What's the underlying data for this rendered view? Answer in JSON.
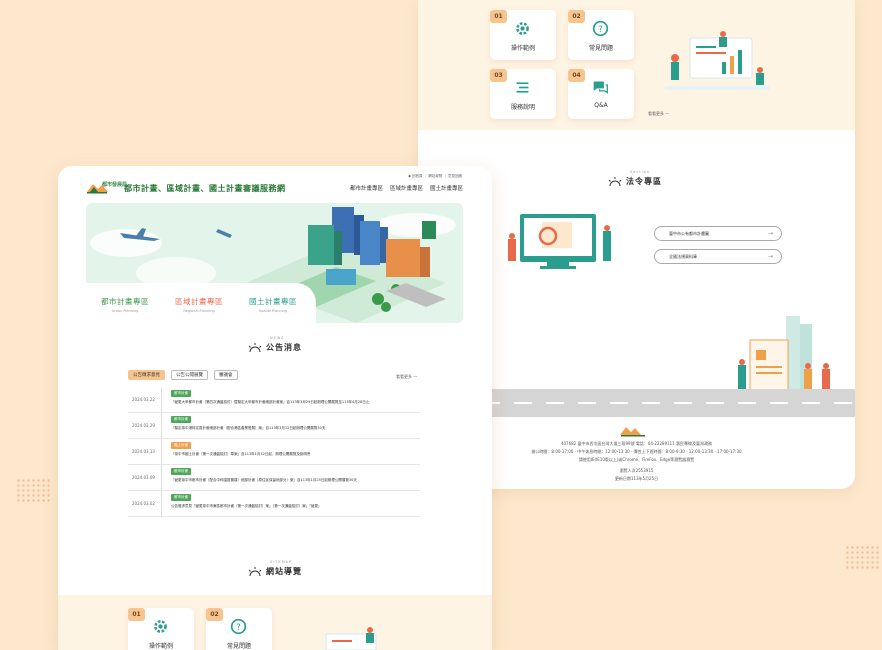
{
  "back": {
    "tiles": [
      {
        "num": "01",
        "label": "操作範例",
        "icon": "gear-icon"
      },
      {
        "num": "02",
        "label": "常見問題",
        "icon": "question-icon"
      },
      {
        "num": "03",
        "label": "服務說明",
        "icon": "list-icon"
      },
      {
        "num": "04",
        "label": "Q&A",
        "icon": "chat-icon"
      }
    ],
    "more_label": "看看更多",
    "law_section": {
      "en": "Section",
      "zh": "法令專區"
    },
    "law_buttons": [
      "臺中市公有都市計畫圖",
      "全國法規資料庫"
    ],
    "footer": {
      "address": "407682 臺中市西屯區台灣大道三段99號  電話：04-22289111 惠民專線及臺灣政務",
      "hours": "辦公時間：8:00-17:00 ‧ 中午休息時間：12:00-13:30 ‧ 彈性上下班時間：8:00-9:30 ‧ 12:00-13:30 ‧ 17:00-17:30",
      "browser": "請使用IE(IE10版以上)或Chrome、FireFox、Edge等瀏覽器瀏覽",
      "visitors": "瀏覽人次2553915",
      "updated": "更新日期113年5月25日"
    }
  },
  "front": {
    "top_links": "◆ 回首頁 ｜ 網站導覽 ｜ 意見回饋",
    "logo_text": "都市發展局",
    "site_title": "都市計畫、區域計畫、國土計畫審議服務網",
    "nav": [
      "都市計畫專區",
      "區域計畫專區",
      "國土計畫專區"
    ],
    "hero_tabs": [
      {
        "zh": "都市計畫專區",
        "en": "Urban Planning"
      },
      {
        "zh": "區域計畫專區",
        "en": "Regional Planning"
      },
      {
        "zh": "國土計畫專區",
        "en": "Spatial Planning"
      }
    ],
    "news_section": {
      "en": "NEWS",
      "zh": "公告消息"
    },
    "filter_tabs": [
      "公告徵求意見",
      "公告公開展覽",
      "審議會"
    ],
    "more_label": "看看更多",
    "news": [
      {
        "date": "2024.03.22",
        "tag": "都市計畫",
        "tag_color": "#4fa85a",
        "title": "『變更大甲都市計畫（第四次通盤檢討）暨擬定大甲都市計畫細部計畫案』自113年3月29日起辦理公開展覽至113年4月28日止"
      },
      {
        "date": "2024.03.29",
        "tag": "都市計畫",
        "tag_color": "#4fa85a",
        "title": "『擬定臺中港特定區計畫細部計畫（配合港區產業發展）案』自113年3月12日起辦理公開展覽30天"
      },
      {
        "date": "2024.03.13",
        "tag": "國土計畫",
        "tag_color": "#f0a04b",
        "title": "『臺中市國土計畫（第一次通盤檢討）草案』自113年1月12日起，辦理公開展覽及說明會"
      },
      {
        "date": "2024.03.09",
        "tag": "都市計畫",
        "tag_color": "#4fa85a",
        "title": "『變更臺中市都市計畫（配合中科園區擴建）細部計畫（原住民保留地部分）案』自113年1月25日起辦理公開展覽30天"
      },
      {
        "date": "2024.03.02",
        "tag": "都市計畫",
        "tag_color": "#4fa85a",
        "title": "公告徵求意見『變更臺中市東區都市計畫（第一次通盤檢討）案』（第一次通盤檢討）案」『變更』"
      }
    ],
    "sitemap_section": {
      "en": "SITEMAP",
      "zh": "網站導覽"
    },
    "tiles": [
      {
        "num": "01",
        "label": "操作範例",
        "icon": "gear-icon"
      },
      {
        "num": "02",
        "label": "常見問題",
        "icon": "question-icon"
      }
    ]
  },
  "colors": {
    "accent": "#f7c48d",
    "green": "#2b7a3a",
    "teal": "#2a9d8f",
    "background": "#fde8cd"
  }
}
